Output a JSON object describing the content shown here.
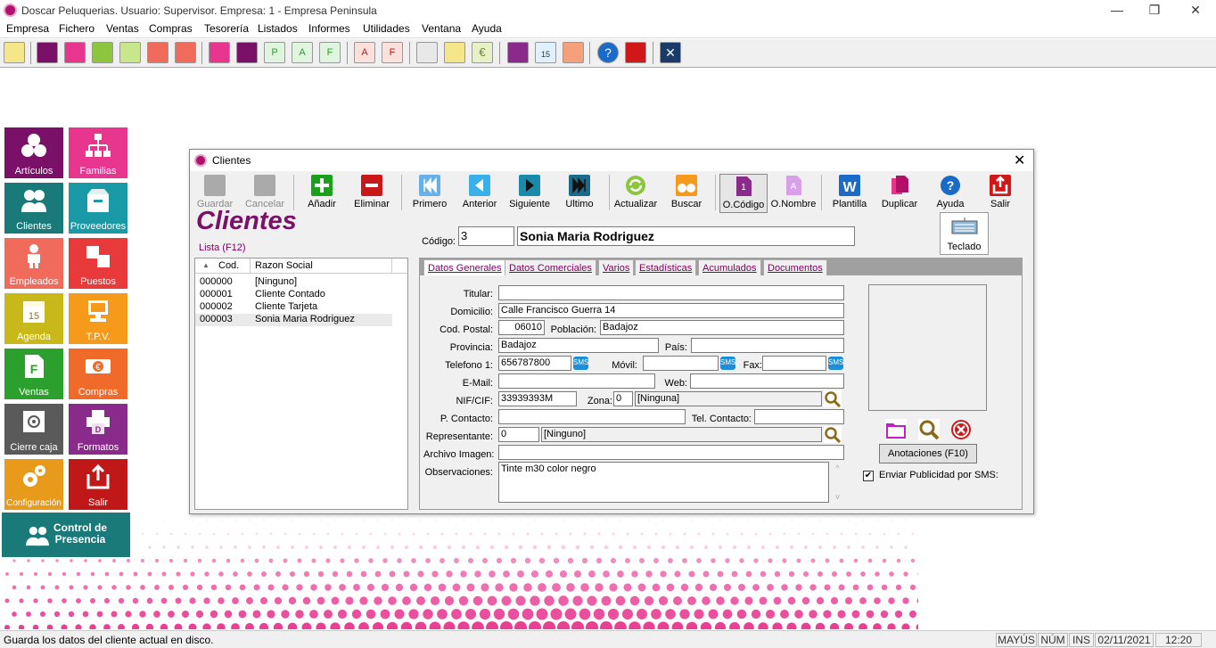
{
  "window": {
    "title": "Doscar Peluquerias. Usuario: Supervisor. Empresa: 1 - Empresa Peninsula"
  },
  "menu": [
    "Empresa",
    "Fichero",
    "Ventas",
    "Compras",
    "Tesorería",
    "Listados",
    "Informes",
    "Utilidades",
    "Ventana",
    "Ayuda"
  ],
  "sidebar": {
    "tiles": [
      {
        "label": "Artículos",
        "color": "#7a1068"
      },
      {
        "label": "Familias",
        "color": "#e8368f"
      },
      {
        "label": "Clientes",
        "color": "#1a7a7a"
      },
      {
        "label": "Proveedores",
        "color": "#1a9aa6"
      },
      {
        "label": "Empleados",
        "color": "#f06b5c"
      },
      {
        "label": "Puestos",
        "color": "#e83a3a"
      },
      {
        "label": "Agenda",
        "color": "#c8b81a"
      },
      {
        "label": "T.P.V.",
        "color": "#f59a1a"
      },
      {
        "label": "Ventas",
        "color": "#2ca02c"
      },
      {
        "label": "Compras",
        "color": "#f06a2a"
      },
      {
        "label": "Cierre caja",
        "color": "#5a5a5a"
      },
      {
        "label": "Formatos",
        "color": "#8a2a8a"
      },
      {
        "label": "Configuración",
        "color": "#e89a1a"
      },
      {
        "label": "Salir",
        "color": "#c01818"
      }
    ],
    "control": {
      "line1": "Control de",
      "line2": "Presencia",
      "color": "#1a7a7a"
    }
  },
  "dialog": {
    "title": "Clientes",
    "close": "✕",
    "buttons": [
      {
        "label": "Guardar",
        "icon": "save-icon",
        "disabled": true
      },
      {
        "label": "Cancelar",
        "icon": "cancel-icon",
        "disabled": true
      },
      {
        "label": "Añadir",
        "icon": "add-icon"
      },
      {
        "label": "Eliminar",
        "icon": "delete-icon"
      },
      {
        "label": "Primero",
        "icon": "first-icon"
      },
      {
        "label": "Anterior",
        "icon": "previous-icon"
      },
      {
        "label": "Siguiente",
        "icon": "next-icon"
      },
      {
        "label": "Ultimo",
        "icon": "last-icon"
      },
      {
        "label": "Actualizar",
        "icon": "refresh-icon"
      },
      {
        "label": "Buscar",
        "icon": "binoculars-icon"
      },
      {
        "label": "O.Código",
        "icon": "sort-code-icon"
      },
      {
        "label": "O.Nombre",
        "icon": "sort-name-icon"
      },
      {
        "label": "Plantilla",
        "icon": "word-icon"
      },
      {
        "label": "Duplicar",
        "icon": "duplicate-icon"
      },
      {
        "label": "Ayuda",
        "icon": "help-icon"
      },
      {
        "label": "Salir",
        "icon": "exit-icon"
      }
    ],
    "heading": "Clientes",
    "list_label": "Lista (F12)",
    "codigo_label": "Código:",
    "codigo_value": "3",
    "nombre_value": "Sonia Maria Rodriguez",
    "teclado": "Teclado",
    "list": {
      "columns": [
        "Cod.",
        "Razon Social"
      ],
      "rows": [
        [
          "000000",
          "[Ninguno]"
        ],
        [
          "000001",
          "Cliente Contado"
        ],
        [
          "000002",
          "Cliente Tarjeta"
        ],
        [
          "000003",
          "Sonia Maria Rodriguez"
        ]
      ]
    },
    "tabs": [
      "Datos Generales",
      "Datos Comerciales",
      "Varios",
      "Estadísticas",
      "Acumulados",
      "Documentos"
    ],
    "form": {
      "titular_label": "Titular:",
      "titular": "",
      "domicilio_label": "Domicilio:",
      "domicilio": "Calle Francisco Guerra 14",
      "cp_label": "Cod. Postal:",
      "cp": "06010",
      "poblacion_label": "Población:",
      "poblacion": "Badajoz",
      "provincia_label": "Provincia:",
      "provincia": "Badajoz",
      "pais_label": "País:",
      "pais": "",
      "telefono_label": "Telefono 1:",
      "telefono": "656787800",
      "movil_label": "Móvil:",
      "movil": "",
      "fax_label": "Fax:",
      "fax": "",
      "email_label": "E-Mail:",
      "email": "",
      "web_label": "Web:",
      "web": "",
      "nif_label": "NIF/CIF:",
      "nif": "33939393M",
      "zona_label": "Zona:",
      "zona_code": "0",
      "zona_name": "[Ninguna]",
      "contacto_label": "P. Contacto:",
      "contacto": "",
      "telcontacto_label": "Tel. Contacto:",
      "telcontacto": "",
      "representante_label": "Representante:",
      "rep_code": "0",
      "rep_name": "[Ninguno]",
      "imagen_label": "Archivo Imagen:",
      "imagen": "",
      "obs_label": "Observaciones:",
      "obs": "Tinte m30 color negro",
      "anotaciones": "Anotaciones (F10)",
      "sms_label": "Enviar Publicidad por SMS:",
      "sms_checked": true
    }
  },
  "status": {
    "message": "Guarda los datos del cliente actual en disco.",
    "mayus": "MAYÚS",
    "num": "NÚM",
    "ins": "INS",
    "date": "02/11/2021",
    "time": "12:20"
  }
}
